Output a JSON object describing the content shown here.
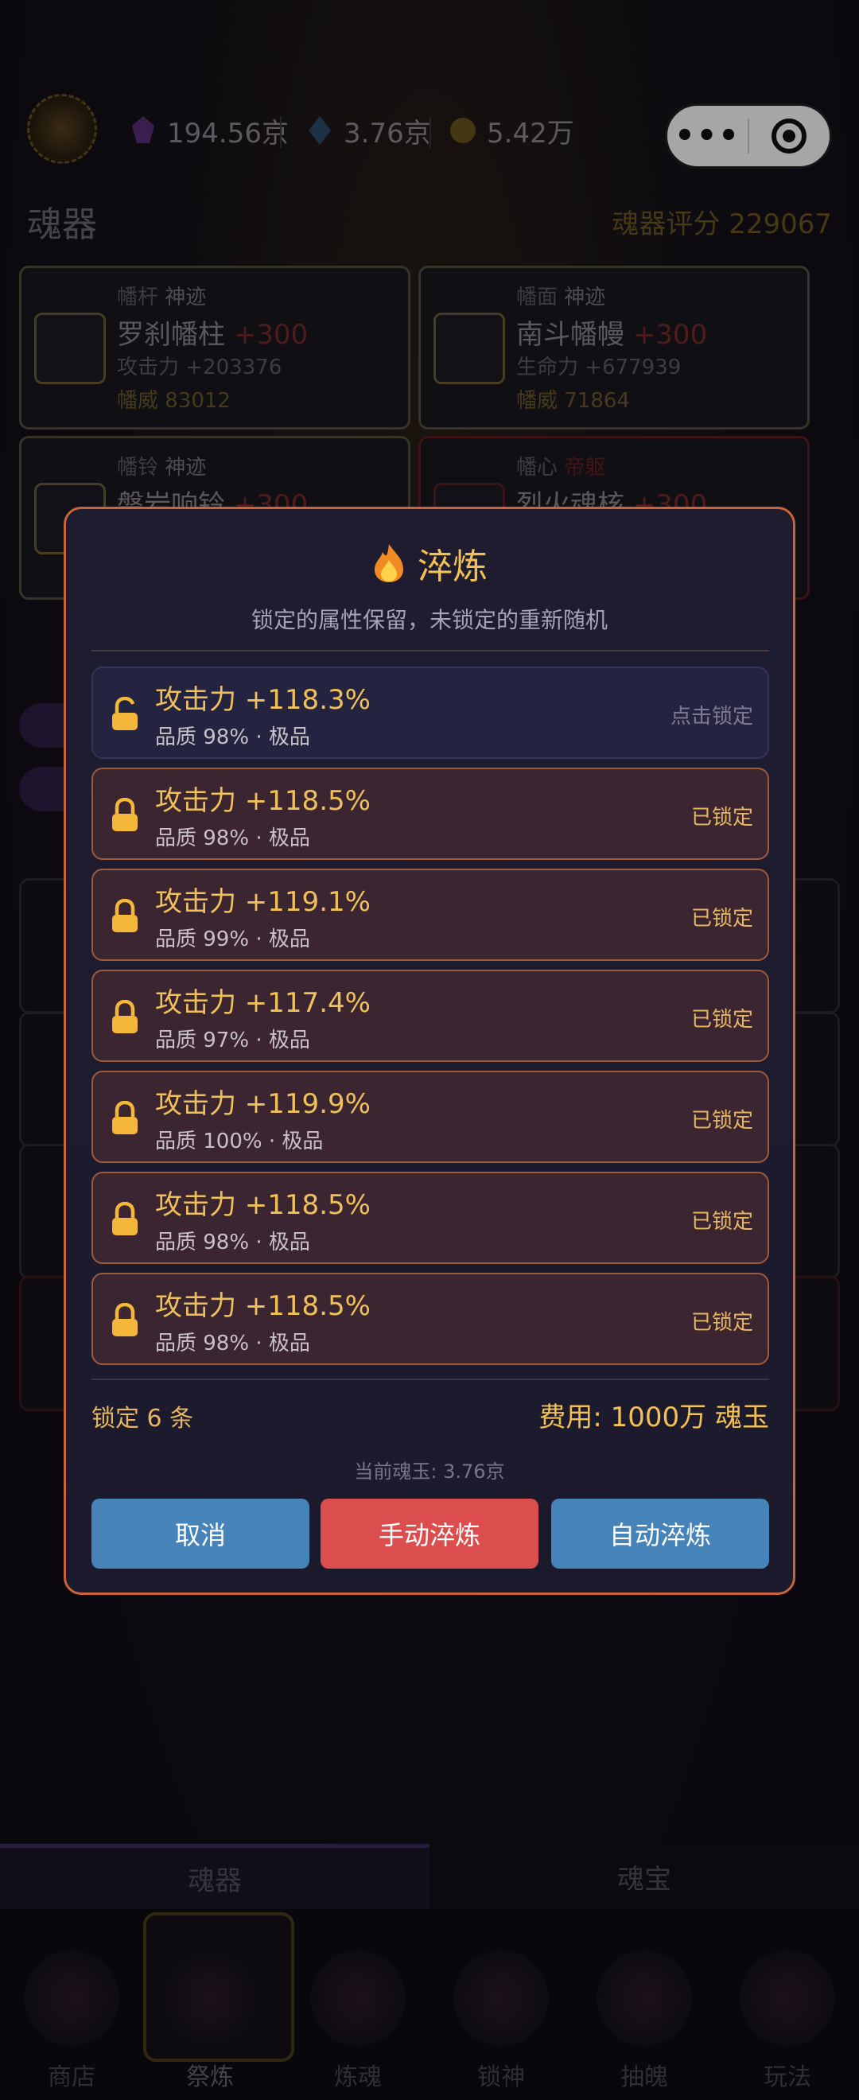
{
  "header": {
    "resources": [
      {
        "icon": "purple-soul-gem-icon",
        "value": "194.56京"
      },
      {
        "icon": "blue-crystal-icon",
        "value": "3.76京"
      },
      {
        "icon": "gold-coin-icon",
        "value": "5.42万"
      }
    ]
  },
  "section": {
    "title": "魂器",
    "score_label": "魂器评分 229067"
  },
  "equipment": [
    {
      "slot": "幡杆",
      "grade": "神迹",
      "name": "罗刹幡柱",
      "plus": "+300",
      "stat": "攻击力 +203376",
      "power": "幡威 83012"
    },
    {
      "slot": "幡面",
      "grade": "神迹",
      "name": "南斗幡幔",
      "plus": "+300",
      "stat": "生命力 +677939",
      "power": "幡威 71864"
    },
    {
      "slot": "幡铃",
      "grade": "神迹",
      "name": "磐岩响铃",
      "plus": "+300"
    },
    {
      "slot": "幡心",
      "grade": "帝躯",
      "name": "烈火魂核",
      "plus": "+300"
    }
  ],
  "modal": {
    "title": "淬炼",
    "subtitle": "锁定的属性保留，未锁定的重新随机",
    "attributes": [
      {
        "name": "攻击力 +118.3%",
        "quality": "品质 98% · 极品",
        "status": "点击锁定",
        "locked": false
      },
      {
        "name": "攻击力 +118.5%",
        "quality": "品质 98% · 极品",
        "status": "已锁定",
        "locked": true
      },
      {
        "name": "攻击力 +119.1%",
        "quality": "品质 99% · 极品",
        "status": "已锁定",
        "locked": true
      },
      {
        "name": "攻击力 +117.4%",
        "quality": "品质 97% · 极品",
        "status": "已锁定",
        "locked": true
      },
      {
        "name": "攻击力 +119.9%",
        "quality": "品质 100% · 极品",
        "status": "已锁定",
        "locked": true
      },
      {
        "name": "攻击力 +118.5%",
        "quality": "品质 98% · 极品",
        "status": "已锁定",
        "locked": true
      },
      {
        "name": "攻击力 +118.5%",
        "quality": "品质 98% · 极品",
        "status": "已锁定",
        "locked": true
      }
    ],
    "lock_count": "锁定 6 条",
    "cost": "费用: 1000万 魂玉",
    "balance": "当前魂玉: 3.76京",
    "buttons": {
      "cancel": "取消",
      "manual": "手动淬炼",
      "auto": "自动淬炼"
    }
  },
  "tabs": [
    "魂器",
    "魂宝"
  ],
  "nav": [
    {
      "label": "商店"
    },
    {
      "label": "祭炼",
      "active": true
    },
    {
      "label": "炼魂"
    },
    {
      "label": "锁神"
    },
    {
      "label": "抽魄"
    },
    {
      "label": "玩法"
    }
  ],
  "colors": {
    "accent_gold": "#f3c152",
    "modal_border": "#c9643a",
    "locked_bg": "#3a2530",
    "cancel_blue": "#4583b9",
    "manual_red": "#dc4d4d"
  }
}
